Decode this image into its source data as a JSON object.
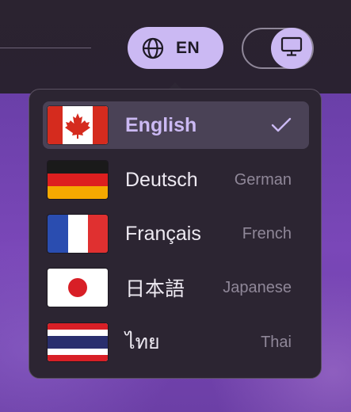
{
  "header": {
    "language_code": "EN"
  },
  "menu": {
    "items": [
      {
        "native": "English",
        "english": "",
        "flag": "canada",
        "selected": true
      },
      {
        "native": "Deutsch",
        "english": "German",
        "flag": "germany",
        "selected": false
      },
      {
        "native": "Français",
        "english": "French",
        "flag": "france",
        "selected": false
      },
      {
        "native": "日本語",
        "english": "Japanese",
        "flag": "japan",
        "selected": false
      },
      {
        "native": "ไทย",
        "english": "Thai",
        "flag": "thailand",
        "selected": false
      }
    ]
  },
  "colors": {
    "accent": "#cbb9f3",
    "menu_bg": "#2c2532",
    "selected_bg": "#4a4256",
    "page_purple": "#7a47b8"
  },
  "icons": {
    "language_button": "globe-icon",
    "theme_toggle": "monitor-icon",
    "selected_marker": "checkmark-icon"
  }
}
